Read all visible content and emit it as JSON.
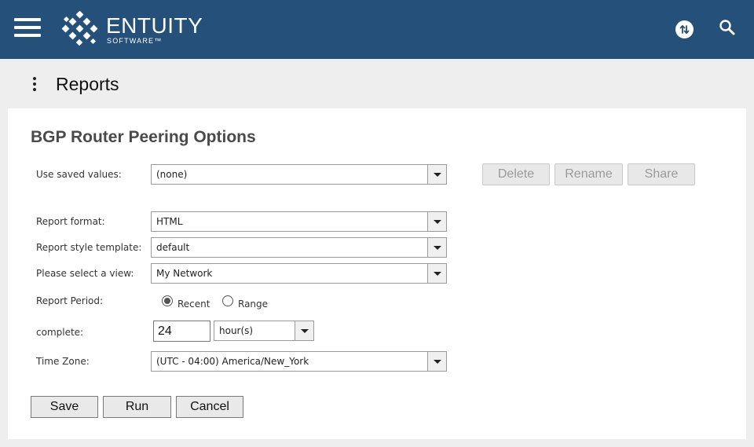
{
  "app": {
    "brand_name": "ENTUITY",
    "brand_sub": "SOFTWARE™"
  },
  "header": {
    "menu_icon": "hamburger-menu-icon",
    "switch_icon": "switch-arrows-icon",
    "search_icon": "search-icon",
    "bar_color": "#24507a"
  },
  "page": {
    "title": "Reports"
  },
  "form": {
    "title": "BGP Router Peering Options",
    "saved_values": {
      "label": "Use saved values:",
      "value": "(none)"
    },
    "actions_disabled": {
      "delete": "Delete",
      "rename": "Rename",
      "share": "Share"
    },
    "report_format": {
      "label": "Report format:",
      "value": "HTML"
    },
    "style_template": {
      "label": "Report style template:",
      "value": "default"
    },
    "view": {
      "label": "Please select a view:",
      "value": "My Network"
    },
    "period": {
      "label": "Report Period:",
      "options": [
        "Recent",
        "Range"
      ],
      "selected": "Recent"
    },
    "complete": {
      "label": "complete:",
      "value": "24",
      "unit": "hour(s)"
    },
    "timezone": {
      "label": "Time Zone:",
      "value": "(UTC - 04:00) America/New_York"
    },
    "buttons": {
      "save": "Save",
      "run": "Run",
      "cancel": "Cancel"
    }
  }
}
